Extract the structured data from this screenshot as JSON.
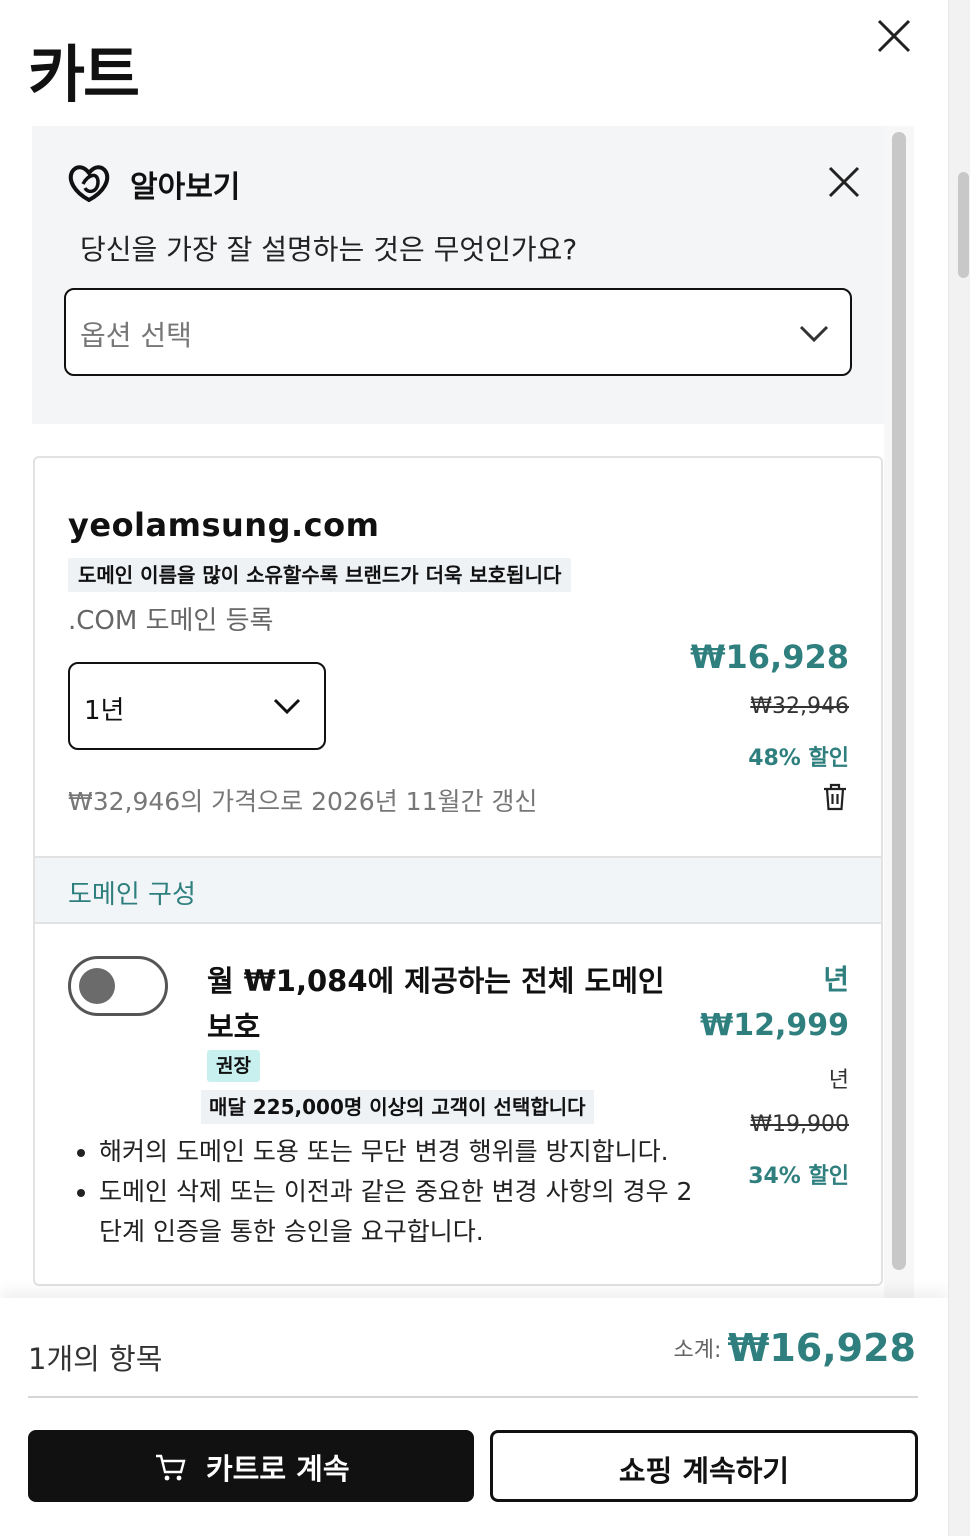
{
  "header": {
    "title": "카트"
  },
  "survey": {
    "title": "알아보기",
    "question": "당신을 가장 잘 설명하는 것은 무엇인가요?",
    "select_placeholder": "옵션 선택"
  },
  "domain_item": {
    "name": "yeolamsung.com",
    "promo_tag": "도메인 이름을 많이 소유할수록 브랜드가 더욱 보호됩니다",
    "registration_label": ".COM 도메인 등록",
    "term": "1년",
    "price": "₩16,928",
    "original_price": "₩32,946",
    "discount": "48% 할인",
    "renewal_note": "₩32,946의 가격으로 2026년 11월간 갱신"
  },
  "domain_config": {
    "section_label": "도메인 구성",
    "protection": {
      "title": "월 ₩1,084에 제공하는 전체 도메인 보호",
      "badge": "권장",
      "customers_tag": "매달 225,000명 이상의 고객이 선택합니다",
      "bullets": [
        "해커의 도메인 도용 또는 무단 변경 행위를 방지합니다.",
        "도메인 삭제 또는 이전과 같은 중요한 변경 사항의 경우 2단계 인증을 통한 승인을 요구합니다."
      ],
      "price_unit_top": "년",
      "price": "₩12,999",
      "price_unit": "년",
      "original_price": "₩19,900",
      "discount": "34% 할인",
      "enabled": false
    }
  },
  "footer": {
    "item_count": "1개의 항목",
    "subtotal_label": "소계:",
    "subtotal_amount": "₩16,928",
    "checkout_label": "카트로 계속",
    "continue_shopping_label": "쇼핑 계속하기"
  },
  "colors": {
    "accent_teal": "#2f7f7f",
    "badge_bg": "#c7f0ee",
    "primary_button": "#111111"
  },
  "icons": [
    "close-icon",
    "godaddy-logo-icon",
    "chevron-down-icon",
    "trash-icon",
    "cart-icon"
  ]
}
